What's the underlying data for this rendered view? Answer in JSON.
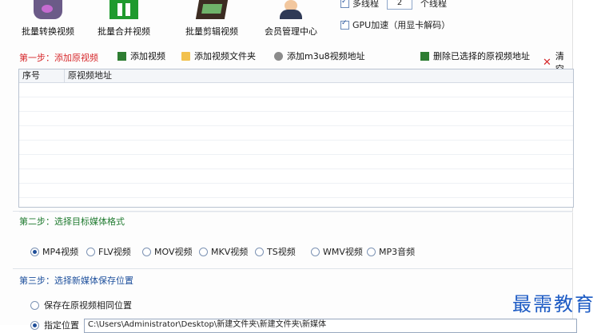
{
  "toolbar": {
    "items": [
      {
        "label": "批量转换视频",
        "icon": "video-convert-icon"
      },
      {
        "label": "批量合并视频",
        "icon": "video-merge-icon"
      },
      {
        "label": "批量剪辑视频",
        "icon": "film-cut-icon"
      },
      {
        "label": "会员管理中心",
        "icon": "member-icon"
      }
    ]
  },
  "options": {
    "multithread_label": "多线程",
    "thread_count": "2",
    "thread_suffix": "个线程",
    "gpu_label": "GPU加速（用显卡解码）"
  },
  "step1": {
    "title": "第一步：添加原视频",
    "actions": {
      "add_video": "添加视频",
      "add_folder": "添加视频文件夹",
      "add_m3u8": "添加m3u8视频地址",
      "delete_selected": "删除已选择的原视频地址",
      "clear": "清空"
    },
    "table": {
      "col_index": "序号",
      "col_path": "原视频地址"
    }
  },
  "step2": {
    "title": "第二步：选择目标媒体格式",
    "formats": [
      "MP4视频",
      "FLV视频",
      "MOV视频",
      "MKV视频",
      "TS视频",
      "WMV视频",
      "MP3音频"
    ],
    "selected": "MP4视频"
  },
  "step3": {
    "title": "第三步：选择新媒体保存位置",
    "same_location": "保存在原视频相同位置",
    "custom_location": "指定位置",
    "path": "C:\\Users\\Administrator\\Desktop\\新建文件夹\\新建文件夹\\新媒体"
  },
  "watermark": "最需教育",
  "colors": {
    "step1": "#d6282b",
    "step2": "#1f7a2f",
    "step3": "#1d4f9c",
    "watermark": "#1d5bc4"
  }
}
